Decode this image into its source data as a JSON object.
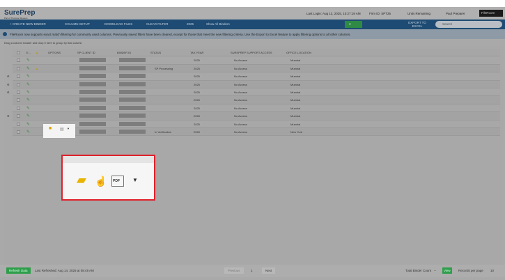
{
  "header": {
    "logo": "SurePrep",
    "logo_sub": "Part of Thomson Reuters",
    "last_login": "Last Login: Aug 13, 2025, 10:27:19 AM",
    "firm_id": "Firm ID: SPT25",
    "units": "Units Remaining",
    "user": "Paul Preparer",
    "app_select": "FileRoom"
  },
  "nav": {
    "create": "+ CREATE NEW BINDER",
    "column_setup": "COLUMN SETUP",
    "download": "DOWNLOAD FILES",
    "clear": "CLEAR FILTER",
    "year": "2025",
    "show": "Show All Binders",
    "alerts": "3",
    "export": "EXPORT TO EXCEL",
    "search_placeholder": "Search"
  },
  "info": "FileRoom now supports exact match filtering for commonly used columns. Previously saved filters have been cleared, except for those that meet the new filtering criteria. Use the Export to Excel feature to apply filtering options to all other columns.",
  "group_hint": "Drag a column header and drop it here to group by that column",
  "columns": [
    "E...",
    "OPTIONS",
    "SP CLIENT ID",
    "BINDER ID",
    "STATUS",
    "TAX YEAR",
    "SUREPREP SUPPORT ACCESS",
    "OFFICE LOCATION"
  ],
  "rows": [
    {
      "status": "",
      "year": "2025",
      "access": "No Access",
      "office": "Mumbai",
      "warn": false,
      "gear": false
    },
    {
      "status": "SP Processing",
      "year": "2025",
      "access": "No Access",
      "office": "Mumbai",
      "warn": true,
      "gear": false
    },
    {
      "status": "",
      "year": "2025",
      "access": "No Access",
      "office": "Mumbai",
      "warn": false,
      "gear": true
    },
    {
      "status": "",
      "year": "2025",
      "access": "No Access",
      "office": "Mumbai",
      "warn": false,
      "gear": true
    },
    {
      "status": "",
      "year": "2025",
      "access": "No Access",
      "office": "Mumbai",
      "warn": false,
      "gear": true
    },
    {
      "status": "",
      "year": "2025",
      "access": "No Access",
      "office": "Mumbai",
      "warn": false,
      "gear": false
    },
    {
      "status": "",
      "year": "2025",
      "access": "No Access",
      "office": "Mumbai",
      "warn": false,
      "gear": false
    },
    {
      "status": "",
      "year": "2025",
      "access": "No Access",
      "office": "Mumbai",
      "warn": false,
      "gear": true
    },
    {
      "status": "",
      "year": "2025",
      "access": "No Access",
      "office": "Mumbai",
      "warn": false,
      "gear": false
    },
    {
      "status": "In Verification",
      "year": "2025",
      "access": "No Access",
      "office": "New York",
      "warn": false,
      "gear": false
    }
  ],
  "footer": {
    "refresh": "Refresh Data",
    "last_refreshed": "Last Refreshed: Aug 14, 2025 at 08:49 AM",
    "prev": "Previous",
    "page": "1",
    "next": "Next",
    "total_label": "Total Binder Count",
    "total_value": "--",
    "view": "View",
    "per_page_label": "Records per page",
    "per_page": "10"
  },
  "colors": {
    "nav": "#1e4b73",
    "accent_green": "#2e9e4a",
    "highlight_border": "#e0202a"
  }
}
